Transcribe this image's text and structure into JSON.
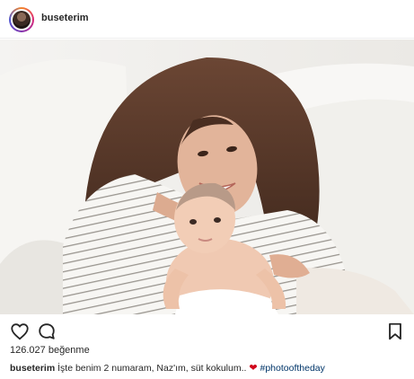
{
  "header": {
    "username": "buseterim"
  },
  "photo": {
    "alt_icon": "photo-image"
  },
  "actions": {
    "like_icon": "heart-outline-icon",
    "comment_icon": "comment-bubble-icon",
    "save_icon": "bookmark-icon"
  },
  "likes": {
    "count": "126.027",
    "label": "beğenme"
  },
  "caption": {
    "username": "buseterim",
    "text": "İşte benim 2 numaram, Naz'ım, süt kokulum..",
    "heart": "❤",
    "hashtag": "#photooftheday"
  },
  "colors": {
    "hashtag": "#003569",
    "heart": "#d0021b",
    "text": "#262626"
  }
}
